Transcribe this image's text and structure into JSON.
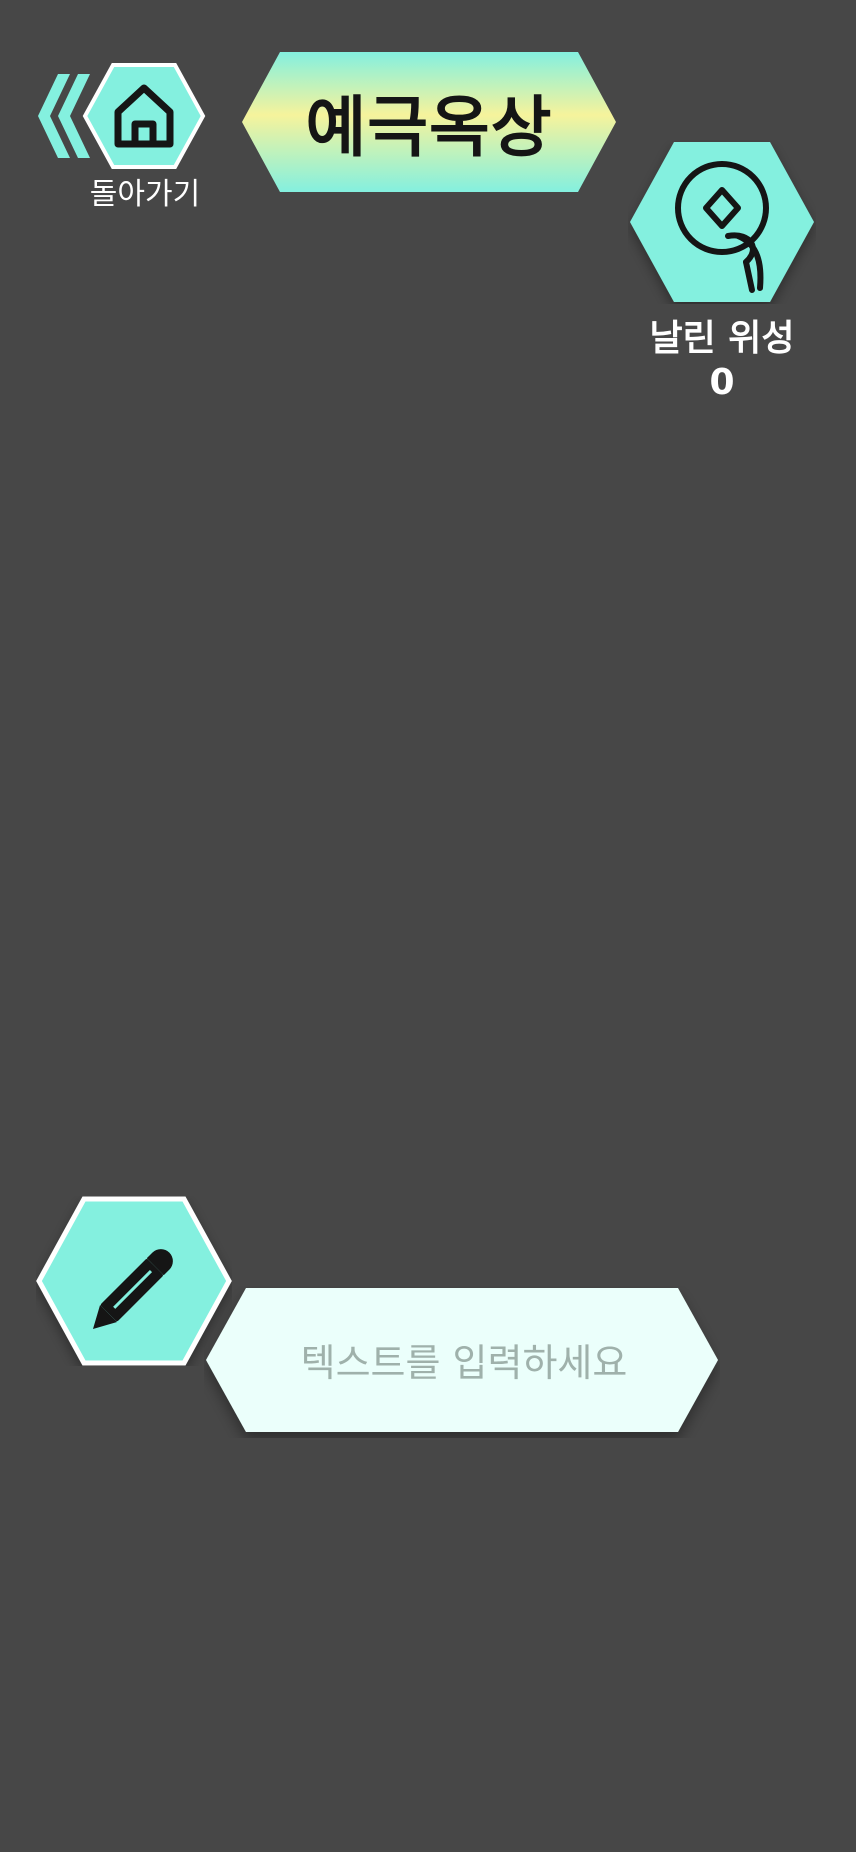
{
  "header": {
    "back_label": "돌아가기",
    "title": "예극옥상"
  },
  "satellite": {
    "label": "날린 위성",
    "count": "0"
  },
  "composer": {
    "placeholder": "텍스트를 입력하세요",
    "value": ""
  },
  "icons": {
    "back": "double-chevron-left-icon",
    "home": "home-icon",
    "satellite": "satellite-coin-icon",
    "pencil": "pencil-icon"
  },
  "colors": {
    "background": "#474747",
    "accent": "#84f0df",
    "title_gradient_top": "#84f0df",
    "title_gradient_mid": "#f6f39c",
    "input_fill": "#ebfffb",
    "text_light": "#ffffff",
    "placeholder": "#9fb1ab"
  }
}
